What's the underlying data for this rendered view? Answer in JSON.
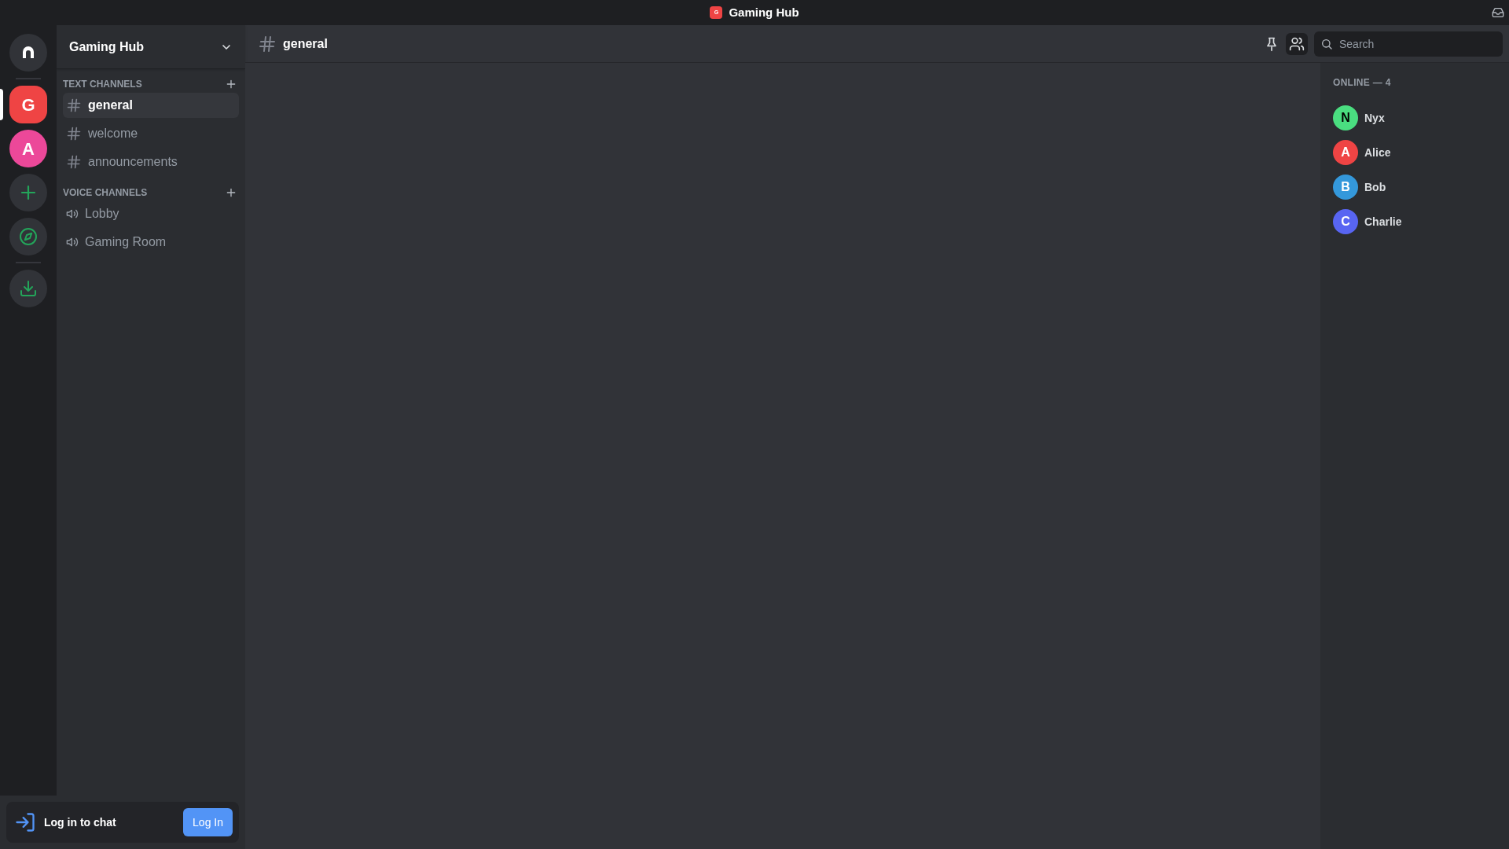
{
  "title_bar": {
    "icon_letter": "G",
    "title": "Gaming Hub"
  },
  "servers": [
    {
      "letter": "G",
      "color": "#ef4444",
      "selected": true
    },
    {
      "letter": "A",
      "color": "#ec4899",
      "selected": false
    }
  ],
  "sidebar": {
    "server_name": "Gaming Hub",
    "categories": [
      {
        "kind": "text",
        "title": "TEXT CHANNELS",
        "channels": [
          {
            "name": "general",
            "selected": true
          },
          {
            "name": "welcome",
            "selected": false
          },
          {
            "name": "announcements",
            "selected": false
          }
        ]
      },
      {
        "kind": "voice",
        "title": "VOICE CHANNELS",
        "channels": [
          {
            "name": "Lobby",
            "selected": false
          },
          {
            "name": "Gaming Room",
            "selected": false
          }
        ]
      }
    ]
  },
  "header": {
    "channel": "general",
    "tools": [
      {
        "kind": "pin",
        "selected": false
      },
      {
        "kind": "members",
        "selected": true
      }
    ],
    "search": {
      "placeholder": "Search"
    }
  },
  "members": {
    "heading": "ONLINE — 4",
    "list": [
      {
        "initial": "N",
        "name": "Nyx",
        "color": "#4ade80"
      },
      {
        "initial": "A",
        "name": "Alice",
        "color": "#ef4444"
      },
      {
        "initial": "B",
        "name": "Bob",
        "color": "#3498db"
      },
      {
        "initial": "C",
        "name": "Charlie",
        "color": "#5865f2"
      }
    ]
  },
  "login_panel": {
    "text": "Log in to chat",
    "button": "Log In"
  }
}
